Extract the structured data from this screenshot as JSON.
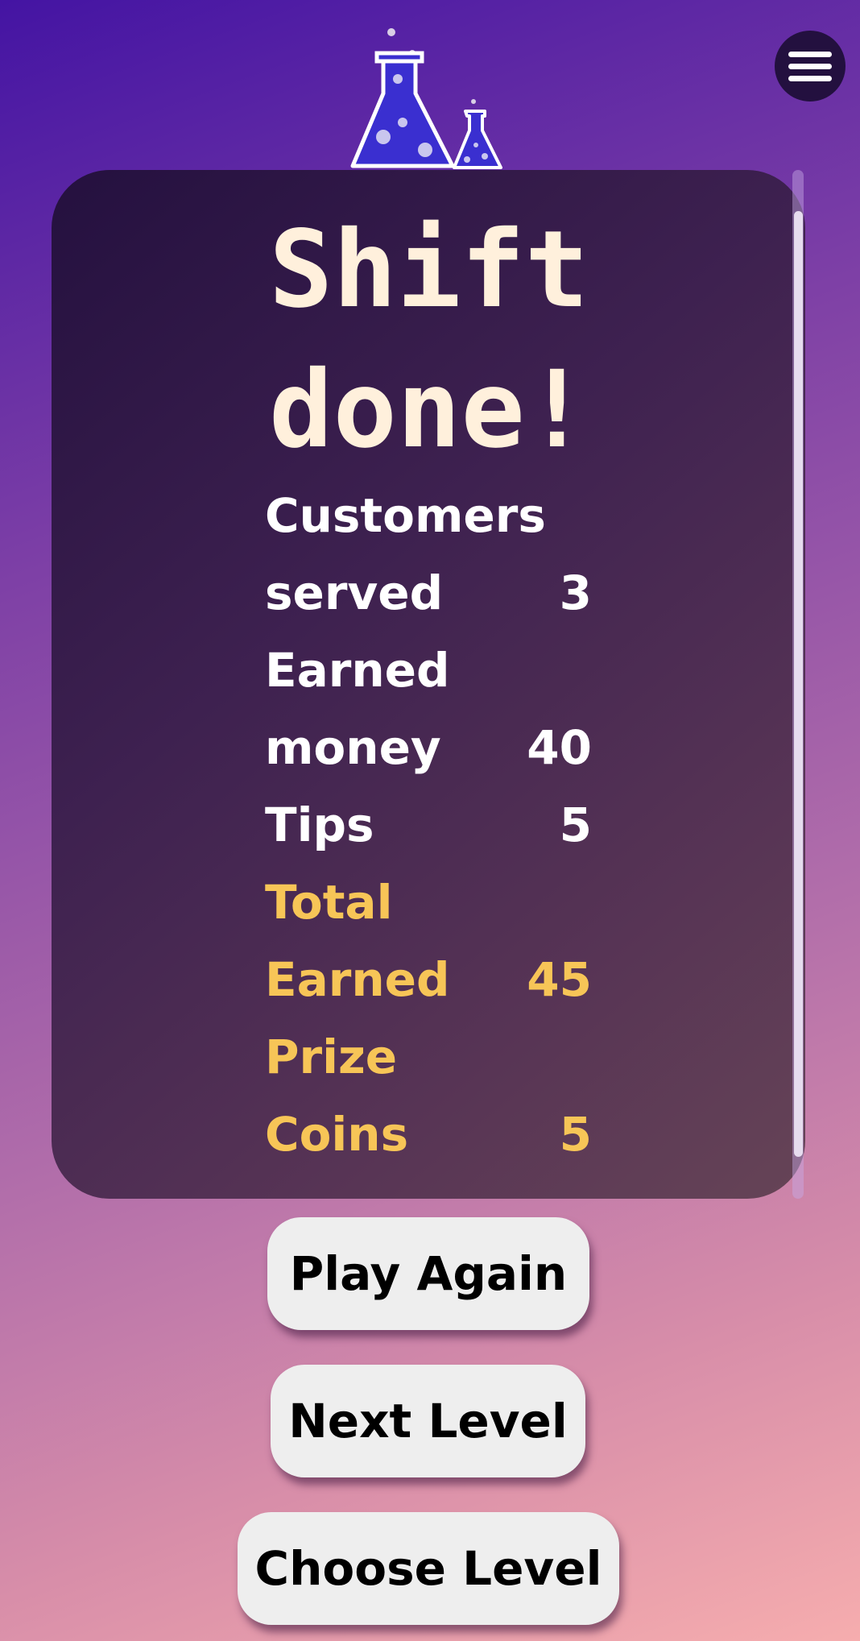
{
  "app": {
    "logo_icon": "flask-icon",
    "menu_icon": "hamburger-menu-icon"
  },
  "colors": {
    "panel_text": "#ffffff",
    "title_text": "#fff0dc",
    "highlight_text": "#f7c557",
    "button_bg": "#eeeeee",
    "menu_bg": "#23103f"
  },
  "results": {
    "title": "Shift\ndone!",
    "stats": [
      {
        "label": "Customers\nserved",
        "value": "3",
        "highlight": false
      },
      {
        "label": "Earned\nmoney",
        "value": "40",
        "highlight": false
      },
      {
        "label": "Tips",
        "value": "5",
        "highlight": false
      },
      {
        "label": "Total\nEarned",
        "value": "45",
        "highlight": true
      },
      {
        "label": "Prize\nCoins",
        "value": "5",
        "highlight": true
      }
    ]
  },
  "buttons": {
    "play_again": "Play Again",
    "next_level": "Next Level",
    "choose_level": "Choose Level"
  }
}
